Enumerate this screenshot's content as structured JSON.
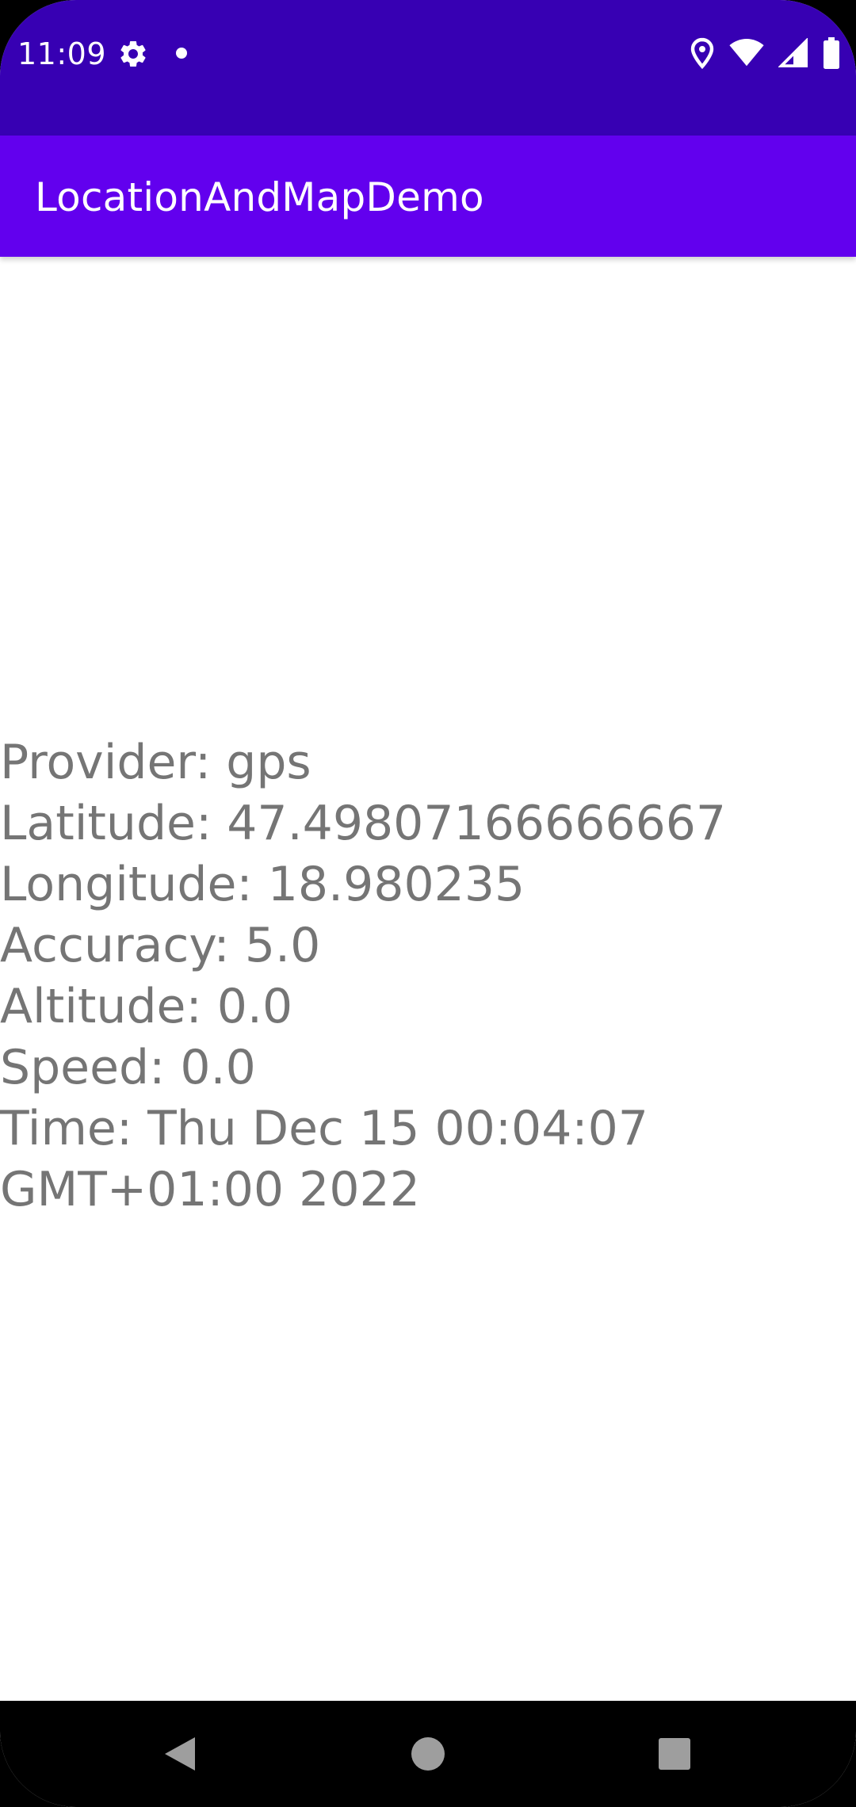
{
  "status_bar": {
    "time": "11:09",
    "icons": [
      "gear-icon",
      "notification-dot-icon",
      "location-pin-icon",
      "wifi-icon",
      "cell-signal-icon",
      "battery-icon"
    ],
    "background": "#3700b3"
  },
  "app_bar": {
    "title": "LocationAndMapDemo",
    "background": "#6200ee"
  },
  "location": {
    "provider": "Provider: gps",
    "latitude": "Latitude: 47.49807166666667",
    "longitude": "Longitude: 18.980235",
    "accuracy": "Accuracy: 5.0",
    "altitude": "Altitude: 0.0",
    "speed": "Speed: 0.0",
    "time_line1": "Time: Thu Dec 15 00:04:07",
    "time_line2": "GMT+01:00 2022",
    "text_color": "#757575"
  },
  "nav_bar": {
    "buttons": [
      "back-icon",
      "home-icon",
      "recents-icon"
    ]
  }
}
